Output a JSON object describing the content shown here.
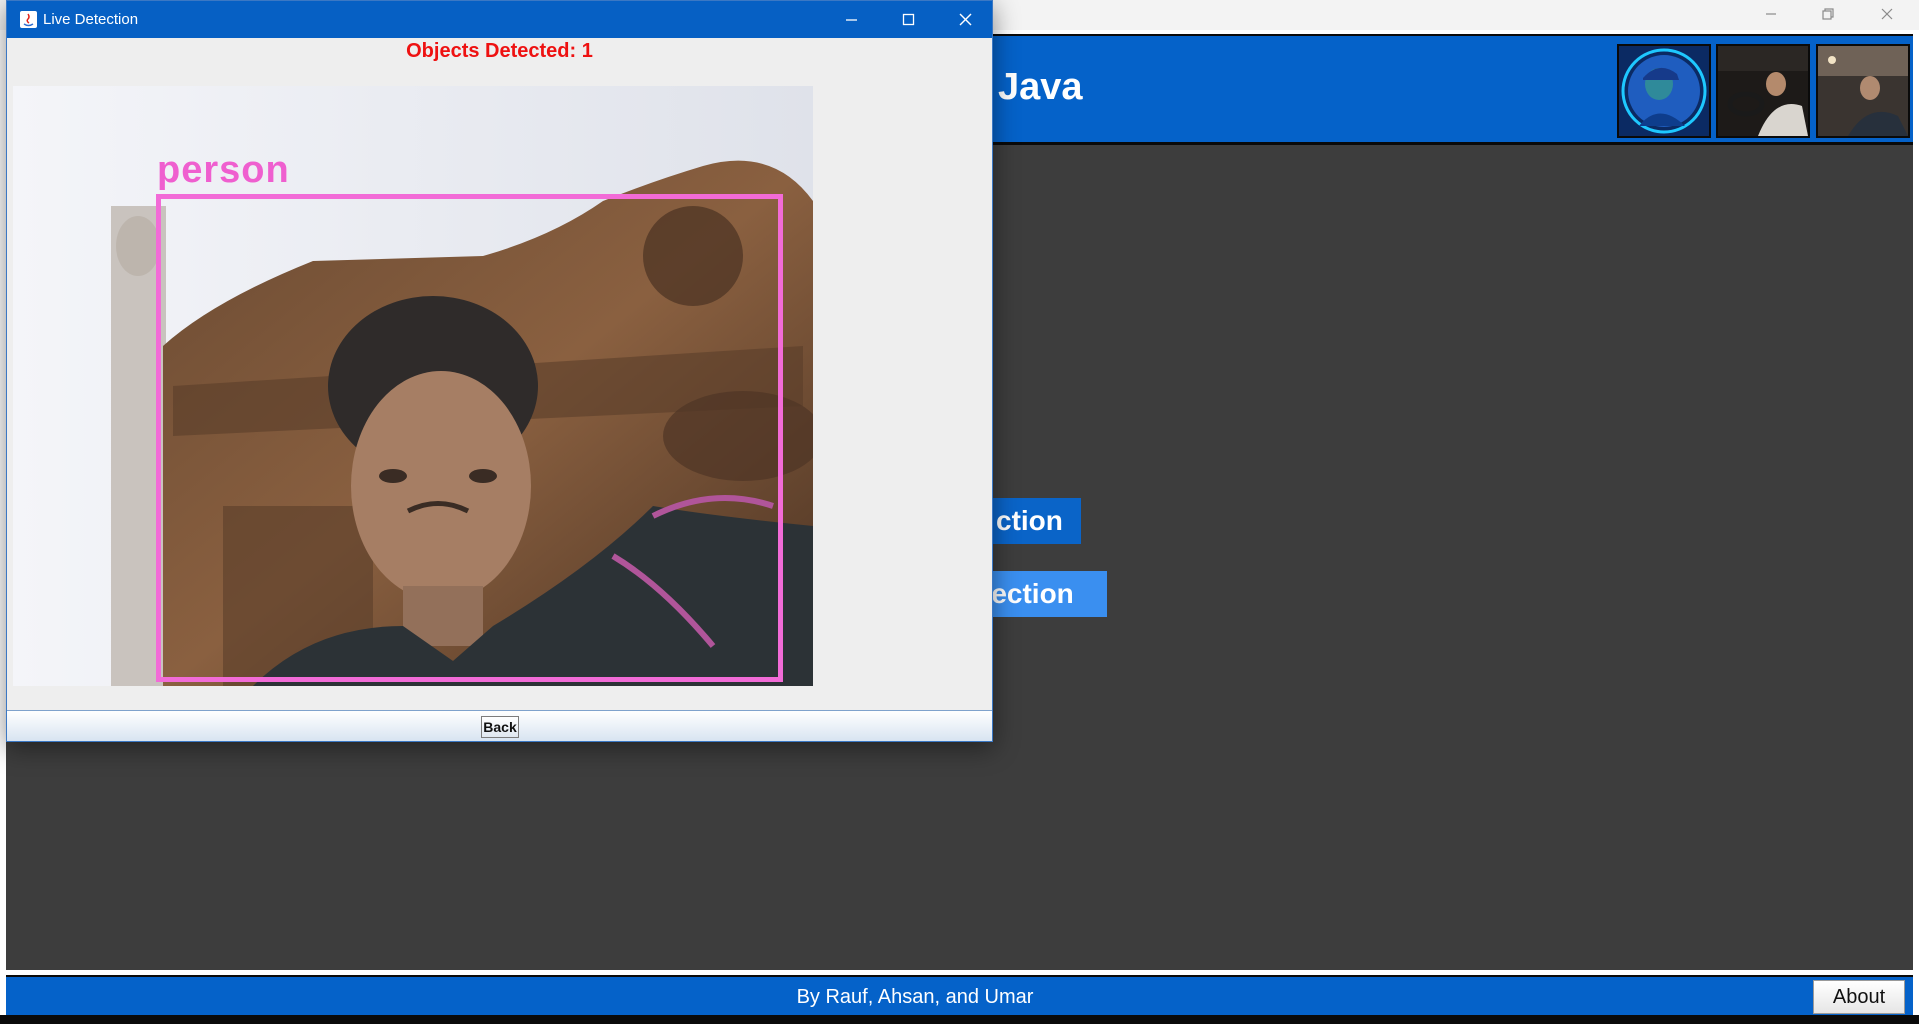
{
  "main_window": {
    "title": "Java",
    "buttons": [
      "ction",
      "tection"
    ],
    "footer_text": "By Rauf, Ahsan, and Umar",
    "about_label": "About"
  },
  "live_window": {
    "title": "Live Detection",
    "objects_detected": "Objects Detected: 1",
    "detection_label": "person",
    "back_label": "Back"
  },
  "colors": {
    "header_blue": "#0562c9",
    "content_dark": "#3d3d3d",
    "button_blue": "#0a64c8",
    "button_light_blue": "#3a8ff0",
    "count_red": "#ee1111",
    "detection_pink": "#f26bd7"
  },
  "icons": [
    "java-app-icon",
    "minimize-icon",
    "maximize-icon",
    "close-icon",
    "restore-icon"
  ]
}
